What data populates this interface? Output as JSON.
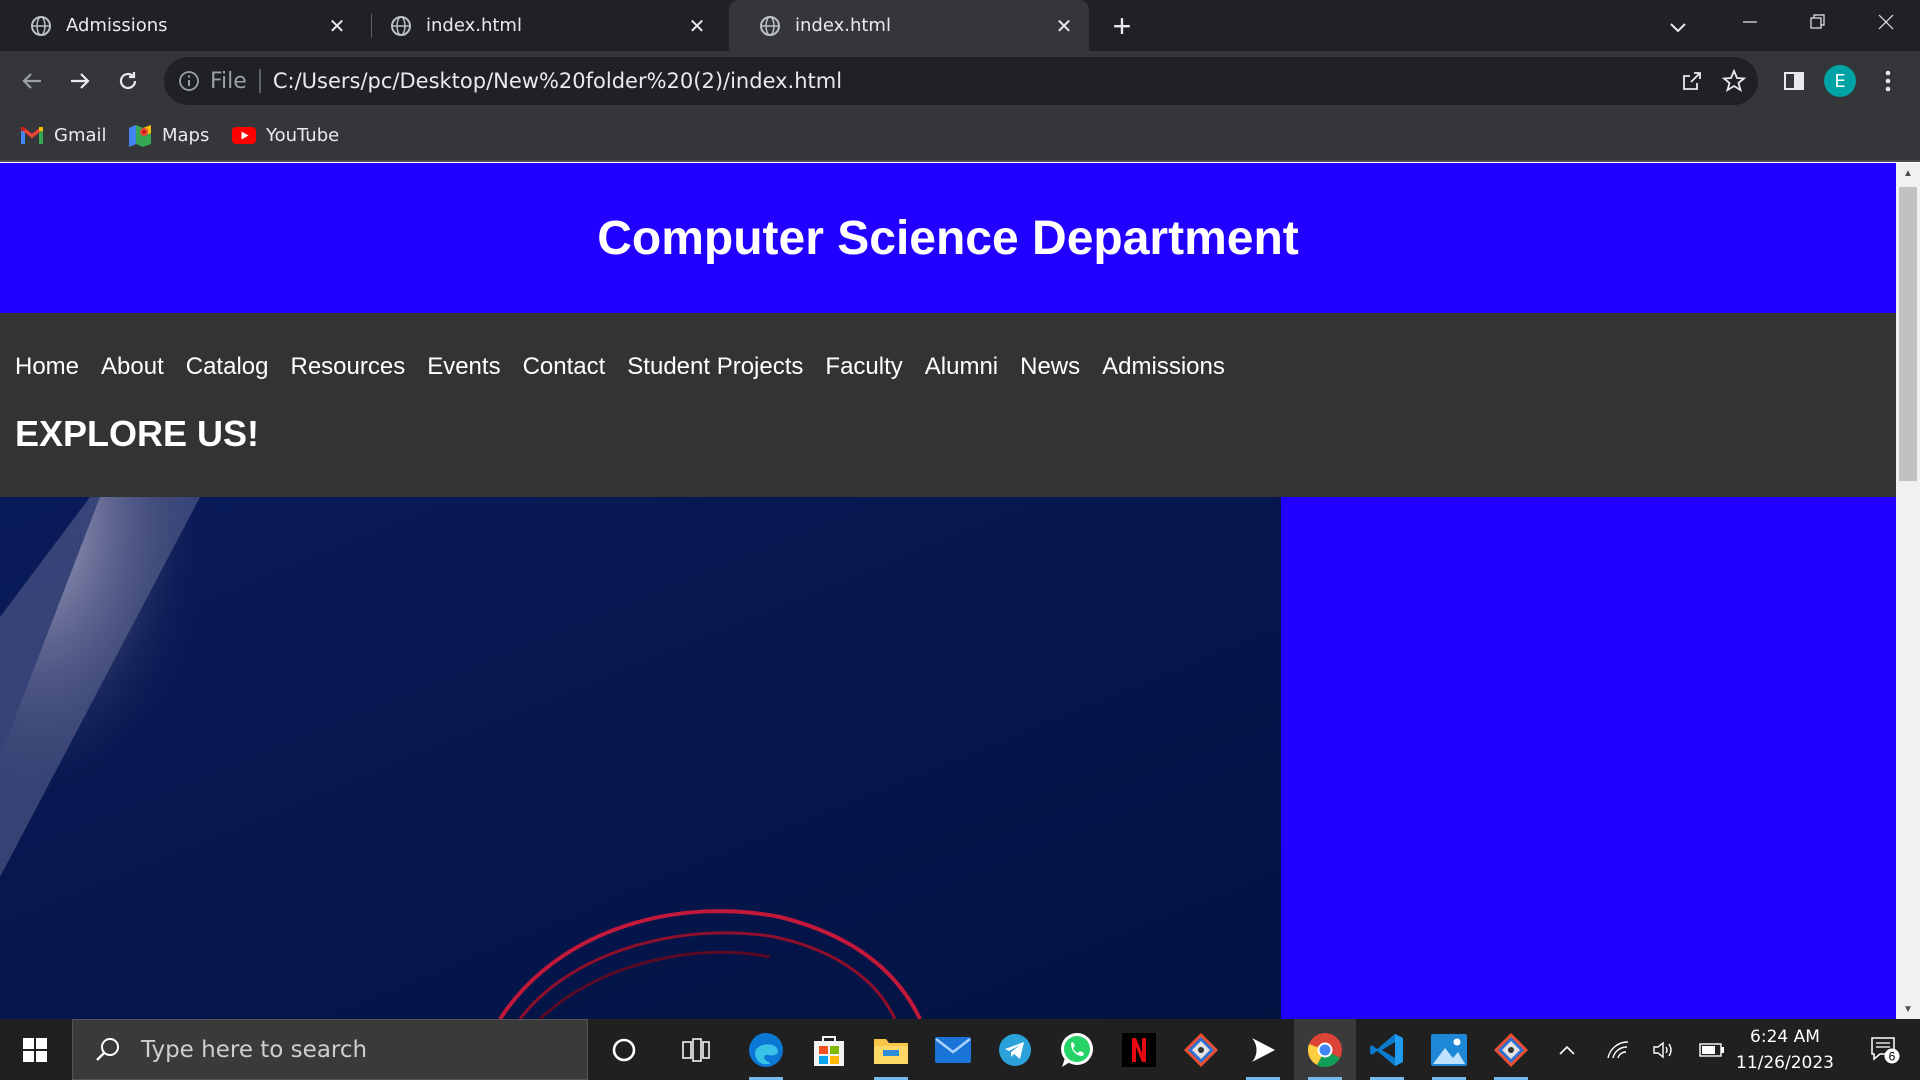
{
  "browser": {
    "tabs": [
      {
        "label": "Admissions",
        "active": false
      },
      {
        "label": "index.html",
        "active": false
      },
      {
        "label": "index.html",
        "active": true
      }
    ],
    "address": {
      "scheme_label": "File",
      "url": "C:/Users/pc/Desktop/New%20folder%20(2)/index.html"
    },
    "profile_initial": "E",
    "bookmarks": [
      {
        "label": "Gmail",
        "icon": "gmail-icon"
      },
      {
        "label": "Maps",
        "icon": "maps-icon"
      },
      {
        "label": "YouTube",
        "icon": "youtube-icon"
      }
    ]
  },
  "page": {
    "header_title": "Computer Science Department",
    "nav": [
      "Home",
      "About",
      "Catalog",
      "Resources",
      "Events",
      "Contact",
      "Student Projects",
      "Faculty",
      "Alumni",
      "News",
      "Admissions"
    ],
    "explore_heading": "EXPLORE US!",
    "colors": {
      "header_bg": "#2200ff",
      "nav_bg": "#333333",
      "side_panel": "#2200ff"
    }
  },
  "taskbar": {
    "search_placeholder": "Type here to search",
    "apps": [
      "cortana-icon",
      "task-view-icon",
      "edge-icon",
      "store-icon",
      "file-explorer-icon",
      "mail-icon",
      "telegram-icon",
      "whatsapp-icon",
      "netflix-icon",
      "git-icon",
      "media-player-icon",
      "chrome-icon",
      "vscode-icon",
      "photos-icon",
      "git-gui-icon"
    ],
    "time": "6:24 AM",
    "date": "11/26/2023",
    "notification_count": "6"
  }
}
